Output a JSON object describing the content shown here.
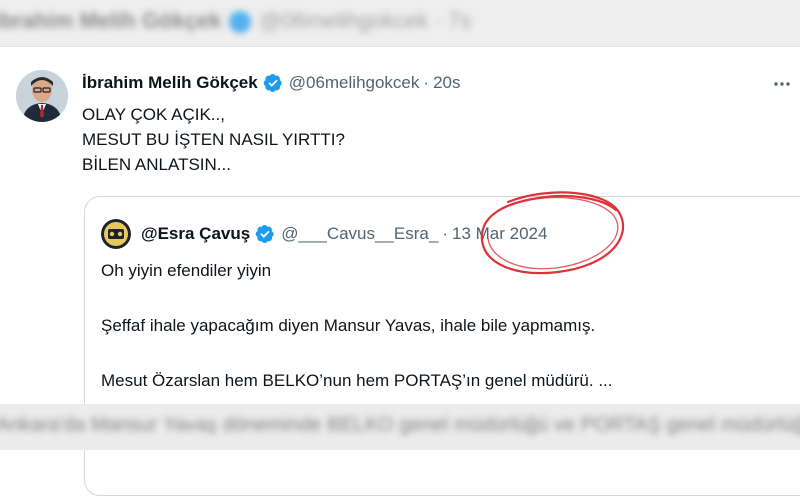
{
  "background_header": {
    "text": "ibrahim Melih Gökçek",
    "handle": "@06melihgokcek · 7s"
  },
  "tweet": {
    "author_name": "İbrahim Melih Gökçek",
    "handle": "@06melihgokcek",
    "separator": "·",
    "time": "20s",
    "more_icon": "more-horizontal-icon",
    "lines": [
      "OLAY ÇOK AÇIK..,",
      "MESUT BU İŞTEN NASIL YIRTTI?",
      "BİLEN ANLATSIN..."
    ]
  },
  "quoted_tweet": {
    "author_name": "@Esra Çavuş",
    "handle": "@___Cavus__Esra_",
    "separator": "·",
    "date": "13 Mar 2024",
    "lines": [
      "Oh yiyin efendiler yiyin",
      "Şeffaf ihale yapacağım diyen Mansur Yavas, ihale bile yapmamış.",
      "Mesut Özarslan hem BELKO’nun hem PORTAŞ’ın genel müdürü. ..."
    ]
  },
  "background_footer": {
    "text": "Ankara'da Mansur Yavaş döneminde BELKO genel müdürlüğü ve PORTAŞ genel müdürlüğü"
  },
  "colors": {
    "verified_badge": "#1d9bf0",
    "secondary_text": "#536471",
    "primary_text": "#0f1419",
    "border": "#cfd9de",
    "highlight_circle": "#e0303a"
  }
}
